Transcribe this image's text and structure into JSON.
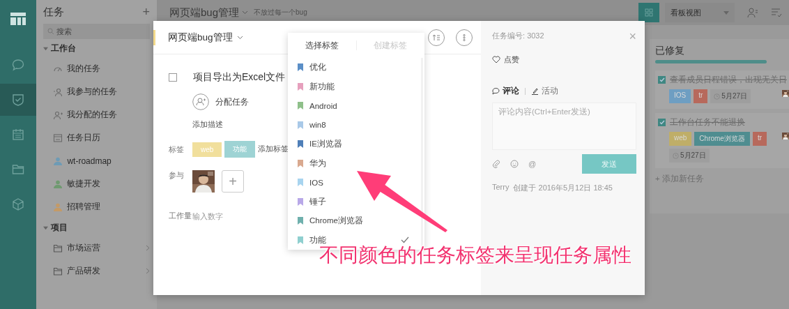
{
  "rail": {
    "items": [
      {
        "kind": "chat",
        "selected": false
      },
      {
        "kind": "tasks",
        "selected": true
      },
      {
        "kind": "calendar",
        "selected": false
      },
      {
        "kind": "folder",
        "selected": false
      },
      {
        "kind": "cube",
        "selected": false
      }
    ]
  },
  "sidebar": {
    "title": "任务",
    "add": "+",
    "search": {
      "placeholder": "搜索"
    },
    "groups": [
      {
        "label": "工作台",
        "expanded": true,
        "children": [
          {
            "label": "我的任务",
            "kind": "gauge"
          },
          {
            "label": "我参与的任务",
            "kind": "person"
          },
          {
            "label": "我分配的任务",
            "kind": "assign"
          },
          {
            "label": "任务日历",
            "kind": "calendar"
          },
          {
            "label": "wt-roadmap",
            "kind": "project",
            "color": "#6e9bb5"
          },
          {
            "label": "敏捷开发",
            "kind": "project",
            "color": "#6f9a70"
          },
          {
            "label": "招聘管理",
            "kind": "project",
            "color": "#c49a66"
          }
        ]
      },
      {
        "label": "项目",
        "expanded": true,
        "children": [
          {
            "label": "市场运营",
            "kind": "folder"
          },
          {
            "label": "产品研发",
            "kind": "folder"
          }
        ]
      }
    ]
  },
  "topbar": {
    "title": "网页端bug管理",
    "subtitle": "不放过每一个bug",
    "view": "看板视图"
  },
  "kanban": {
    "column": "已修复",
    "tasks": [
      {
        "title": "查看成员日程错误，出现无关日",
        "done": true,
        "tags": [
          {
            "label": "IOS",
            "color": "#6e9ec2"
          },
          {
            "label": "tr",
            "color": "#b7695c"
          }
        ],
        "date": "5月27日"
      },
      {
        "title": "工作台任务不能退换",
        "done": true,
        "tags": [
          {
            "label": "web",
            "color": "#bfae68"
          },
          {
            "label": "Chrome浏览器",
            "color": "#4f8d90"
          },
          {
            "label": "tr",
            "color": "#b7695c"
          }
        ],
        "date": "5月27日"
      }
    ],
    "add": "+ 添加新任务"
  },
  "modal": {
    "project": "网页端bug管理",
    "task": {
      "done": false,
      "title": "项目导出为Excel文件"
    },
    "assign": "分配任务",
    "add_description": "添加描述",
    "tags_label": "标签",
    "tags": [
      {
        "label": "web",
        "color": "#f1df9c"
      },
      {
        "label": "功能",
        "color": "#9ed3d4"
      }
    ],
    "add_tag": "添加标签",
    "members_label": "参与",
    "add_member": "+",
    "workload_label": "工作量",
    "workload": {
      "placeholder": "输入数字"
    },
    "detail": {
      "id_label": "任务编号:",
      "id": "3032",
      "close": "×",
      "like": "点赞",
      "tabs": [
        {
          "label": "评论",
          "selected": true
        },
        {
          "label": "活动",
          "selected": false
        }
      ],
      "comment": {
        "placeholder": "评论内容(Ctrl+Enter发送)"
      },
      "mention": "@",
      "send": "发送",
      "author": "Terry",
      "created": "创建于 2016年5月12日 18:45"
    }
  },
  "tag_picker": {
    "tabs": [
      {
        "label": "选择标签",
        "selected": true
      },
      {
        "label": "创建标签",
        "selected": false
      }
    ],
    "items": [
      {
        "label": "优化",
        "color": "#5b8fc7",
        "selected": false
      },
      {
        "label": "新功能",
        "color": "#e6a0bd",
        "selected": false
      },
      {
        "label": "Android",
        "color": "#8fc08a",
        "selected": false
      },
      {
        "label": "win8",
        "color": "#a9c9e8",
        "selected": false
      },
      {
        "label": "IE浏览器",
        "color": "#4f7fb8",
        "selected": false
      },
      {
        "label": "华为",
        "color": "#d9a98f",
        "selected": false
      },
      {
        "label": "IOS",
        "color": "#a8d4ef",
        "selected": false
      },
      {
        "label": "锤子",
        "color": "#b8a8e8",
        "selected": false
      },
      {
        "label": "Chrome浏览器",
        "color": "#6fb0ad",
        "selected": false
      },
      {
        "label": "功能",
        "color": "#8fcfcf",
        "selected": true
      }
    ]
  },
  "annotation": {
    "text": "不同颜色的任务标签来呈现任务属性"
  }
}
